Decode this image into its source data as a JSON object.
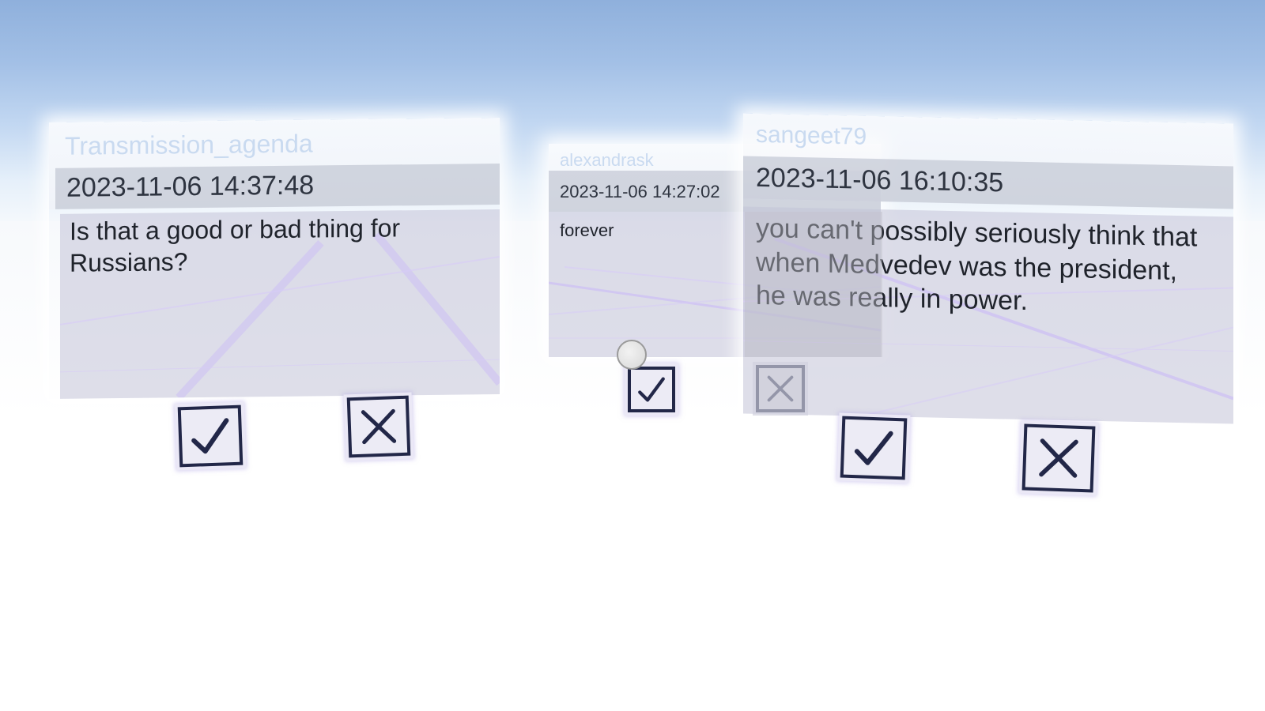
{
  "comments": [
    {
      "username": "Transmission_agenda",
      "timestamp": "2023-11-06 14:37:48",
      "text": "Is that a good or bad thing for Russians?",
      "approve_icon": "check-icon",
      "reject_icon": "x-icon"
    },
    {
      "username": "alexandrask",
      "timestamp": "2023-11-06 14:27:02",
      "text": "forever",
      "approve_icon": "check-icon",
      "reject_icon": "x-icon"
    },
    {
      "username": "sangeet79",
      "timestamp": "2023-11-06 16:10:35",
      "text": "you can't possibly seriously think that when Medvedev was the president, he was really in power.",
      "approve_icon": "check-icon",
      "reject_icon": "x-icon"
    }
  ],
  "colors": {
    "sky_top": "#8fb0dc",
    "button_border": "#222748",
    "panel_tint": "#c3c3d7",
    "username_text": "#c9daf0"
  },
  "pointer_icon": "gaze-cursor-icon"
}
